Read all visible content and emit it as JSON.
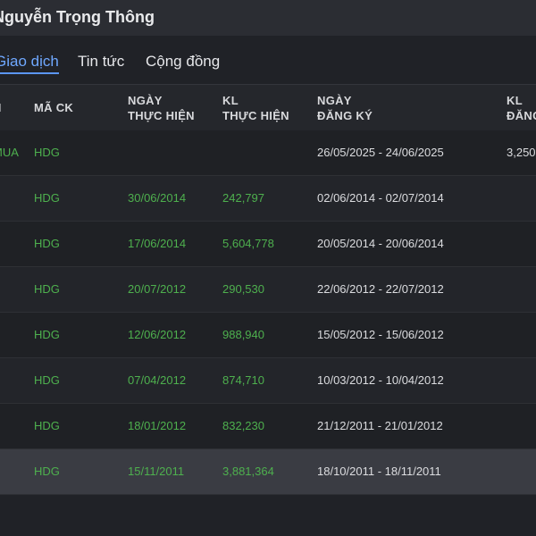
{
  "header": {
    "title": "Nguyễn Trọng Thông"
  },
  "tabs": [
    {
      "label": "Giao dịch",
      "active": true
    },
    {
      "label": "Tin tức",
      "active": false
    },
    {
      "label": "Cộng đồng",
      "active": false
    }
  ],
  "table": {
    "columns": [
      {
        "line1": "H",
        "line2": ""
      },
      {
        "line1": "MÃ CK",
        "line2": ""
      },
      {
        "line1": "NGÀY",
        "line2": "THỰC HIỆN"
      },
      {
        "line1": "KL",
        "line2": "THỰC HIỆN"
      },
      {
        "line1": "NGÀY",
        "line2": "ĐĂNG KÝ"
      },
      {
        "line1": "KL",
        "line2": "ĐĂNG"
      }
    ],
    "rows": [
      {
        "type": "MUA",
        "code": "HDG",
        "exec_date": "",
        "exec_qty": "",
        "reg_period": "26/05/2025 - 24/06/2025",
        "reg_qty": "3,250"
      },
      {
        "type": "",
        "code": "HDG",
        "exec_date": "30/06/2014",
        "exec_qty": "242,797",
        "reg_period": "02/06/2014 - 02/07/2014",
        "reg_qty": ""
      },
      {
        "type": "",
        "code": "HDG",
        "exec_date": "17/06/2014",
        "exec_qty": "5,604,778",
        "reg_period": "20/05/2014 - 20/06/2014",
        "reg_qty": ""
      },
      {
        "type": "",
        "code": "HDG",
        "exec_date": "20/07/2012",
        "exec_qty": "290,530",
        "reg_period": "22/06/2012 - 22/07/2012",
        "reg_qty": ""
      },
      {
        "type": "",
        "code": "HDG",
        "exec_date": "12/06/2012",
        "exec_qty": "988,940",
        "reg_period": "15/05/2012 - 15/06/2012",
        "reg_qty": ""
      },
      {
        "type": "",
        "code": "HDG",
        "exec_date": "07/04/2012",
        "exec_qty": "874,710",
        "reg_period": "10/03/2012 - 10/04/2012",
        "reg_qty": ""
      },
      {
        "type": "",
        "code": "HDG",
        "exec_date": "18/01/2012",
        "exec_qty": "832,230",
        "reg_period": "21/12/2011 - 21/01/2012",
        "reg_qty": ""
      },
      {
        "type": "",
        "code": "HDG",
        "exec_date": "15/11/2011",
        "exec_qty": "3,881,364",
        "reg_period": "18/10/2011 - 18/11/2011",
        "reg_qty": ""
      }
    ]
  },
  "colors": {
    "accent": "#6fa8ff",
    "positive": "#4eb04e",
    "background": "#202227"
  }
}
